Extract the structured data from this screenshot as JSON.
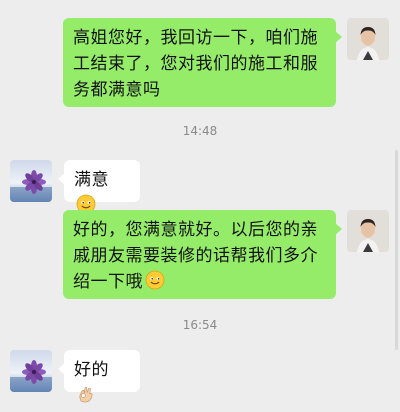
{
  "messages": [
    {
      "side": "out",
      "text": "高姐您好，我回访一下，咱们施工结束了，您对我们的施工和服务都满意吗",
      "emoji": ""
    },
    {
      "side": "timestamp",
      "text": "14:48"
    },
    {
      "side": "in",
      "text": "满意",
      "emoji": "smile-emoji"
    },
    {
      "side": "out",
      "text": "好的，您满意就好。以后您的亲戚朋友需要装修的话帮我们多介绍一下哦",
      "emoji": "smile-emoji"
    },
    {
      "side": "timestamp",
      "text": "16:54"
    },
    {
      "side": "in",
      "text": "好的",
      "emoji": "ok-hand-emoji"
    }
  ],
  "colors": {
    "background": "#ededed",
    "outgoing_bubble": "#95ec69",
    "incoming_bubble": "#ffffff",
    "timestamp_text": "#8a8a8a"
  }
}
